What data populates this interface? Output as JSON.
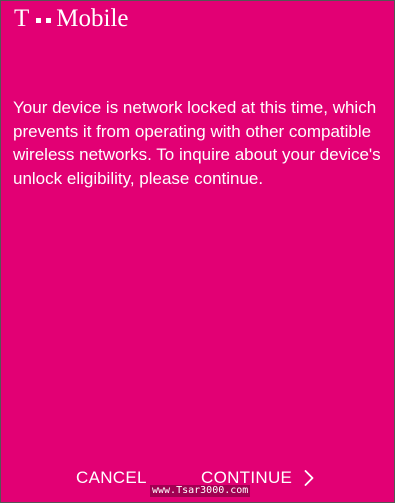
{
  "header": {
    "brand_letter": "T",
    "brand_name": "Mobile",
    "brand_color": "#e20074"
  },
  "main": {
    "message": "Your device is network locked at this time, which prevents it from operating with other compatible wireless networks. To inquire about your device's unlock eligibility, please continue."
  },
  "actions": {
    "cancel_label": "CANCEL",
    "continue_label": "CONTINUE",
    "continue_icon": "chevron-right-icon"
  },
  "watermark": {
    "text": "www.Tsar3000.com"
  }
}
